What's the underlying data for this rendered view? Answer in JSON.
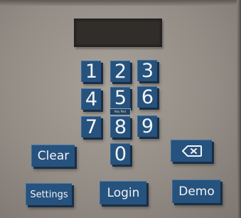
{
  "display": {
    "value": ""
  },
  "keypad": {
    "digits": [
      "1",
      "2",
      "3",
      "4",
      "5",
      "6",
      "7",
      "8",
      "9",
      "0"
    ]
  },
  "tooltip": {
    "text": "Key Pad"
  },
  "buttons": {
    "clear": "Clear",
    "backspace_icon": "backspace-icon",
    "settings": "Settings",
    "login": "Login",
    "demo": "Demo"
  },
  "colors": {
    "key": "#26527e",
    "key_text": "#f3f3f3",
    "display": "#302d2b",
    "wall": "#948d86"
  }
}
